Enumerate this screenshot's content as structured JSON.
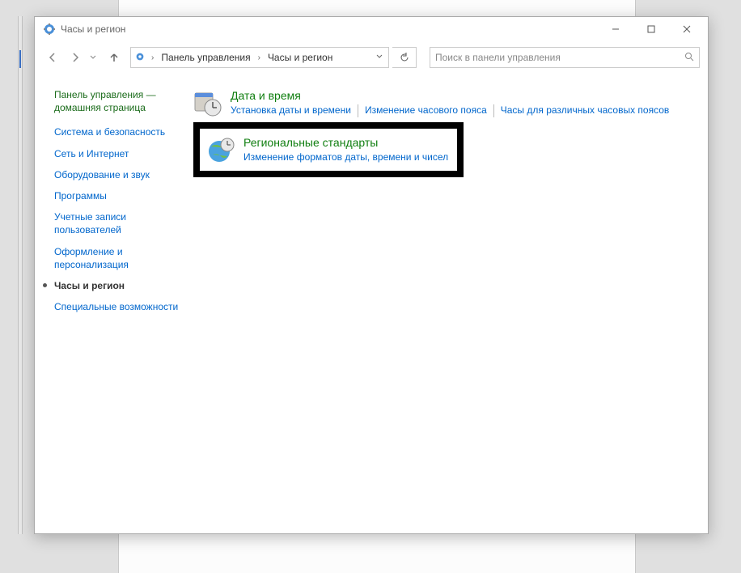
{
  "window": {
    "title": "Часы и регион"
  },
  "breadcrumb": {
    "root": "Панель управления",
    "current": "Часы и регион"
  },
  "search": {
    "placeholder": "Поиск в панели управления"
  },
  "sidebar": {
    "heading": "Панель управления — домашняя страница",
    "items": [
      {
        "label": "Система и безопасность",
        "current": false
      },
      {
        "label": "Сеть и Интернет",
        "current": false
      },
      {
        "label": "Оборудование и звук",
        "current": false
      },
      {
        "label": "Программы",
        "current": false
      },
      {
        "label": "Учетные записи пользователей",
        "current": false
      },
      {
        "label": "Оформление и персонализация",
        "current": false
      },
      {
        "label": "Часы и регион",
        "current": true
      },
      {
        "label": "Специальные возможности",
        "current": false
      }
    ]
  },
  "categories": [
    {
      "title": "Дата и время",
      "links": [
        "Установка даты и времени",
        "Изменение часового пояса",
        "Часы для различных часовых поясов"
      ]
    },
    {
      "title": "Региональные стандарты",
      "links": [
        "Изменение форматов даты, времени и чисел"
      ]
    }
  ]
}
